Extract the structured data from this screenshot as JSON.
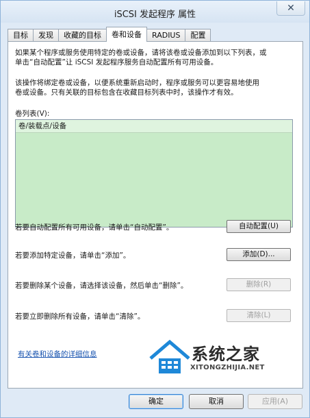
{
  "window": {
    "title": "iSCSI 发起程序 属性",
    "close_glyph": "✕"
  },
  "tabs": [
    {
      "label": "目标"
    },
    {
      "label": "发现"
    },
    {
      "label": "收藏的目标"
    },
    {
      "label": "卷和设备",
      "active": true
    },
    {
      "label": "RADIUS"
    },
    {
      "label": "配置"
    }
  ],
  "panel": {
    "intro_line1": "如果某个程序或服务使用特定的卷或设备，请将该卷或设备添加到以下列表，或",
    "intro_line2": "单击“自动配置”让 iSCSI 发起程序服务自动配置所有可用设备。",
    "bind_line1": "该操作将绑定卷或设备，以便系统重新启动时，程序或服务可以更容易地使用",
    "bind_line2": "卷或设备。只有关联的目标包含在收藏目标列表中时，该操作才有效。",
    "list_label": "卷列表(V):",
    "list_header": "卷/装载点/设备",
    "auto_text": "若要自动配置所有可用设备，请单击“自动配置”。",
    "auto_button": "自动配置(U)",
    "add_text": "若要添加特定设备，请单击“添加”。",
    "add_button": "添加(D)...",
    "remove_text": "若要删除某个设备，请选择该设备，然后单击“删除”。",
    "remove_button": "删除(R)",
    "clear_text": "若要立即删除所有设备，请单击“清除”。",
    "clear_button": "清除(L)",
    "info_link": "有关卷和设备的详细信息"
  },
  "watermark": {
    "text": "系统之家",
    "sub": "XITONGZHIJIA.NET",
    "color": "#1e88d8"
  },
  "footer": {
    "ok": "确定",
    "cancel": "取消",
    "apply": "应用(A)"
  }
}
